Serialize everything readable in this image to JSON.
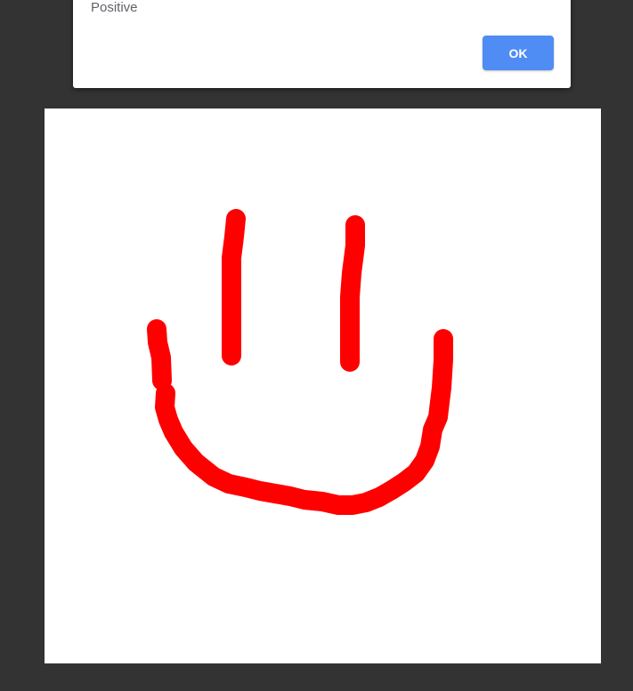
{
  "alert": {
    "message": "Positive",
    "ok_label": "OK"
  },
  "canvas": {
    "background_color": "#ffffff",
    "stroke_color": "#ff0000"
  },
  "colors": {
    "page_background": "#333333",
    "button_primary": "#4f8cf3"
  }
}
